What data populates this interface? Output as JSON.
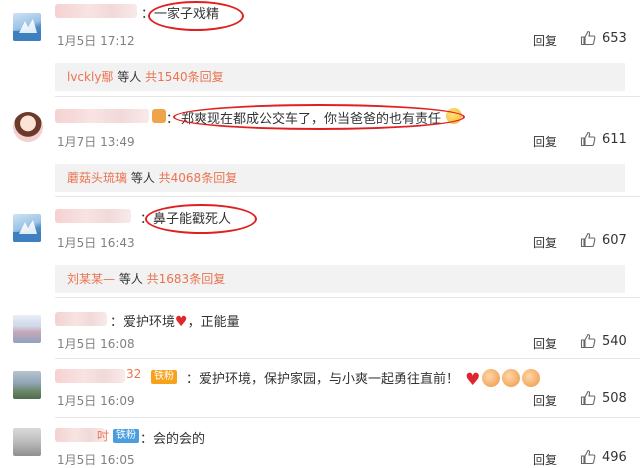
{
  "comments": [
    {
      "text": "：一家子戏精",
      "time": "1月5日 17:12",
      "reply": "回复",
      "likes": "653",
      "replies": {
        "users": "lvckly鄢",
        "mid": " 等人 ",
        "total": "共1540条回复"
      }
    },
    {
      "text_prefix": "：",
      "text": "郑爽现在都成公交车了，你当爸爸的也有责任",
      "time": "1月7日 13:49",
      "reply": "回复",
      "likes": "611",
      "replies": {
        "users": "蘑菇头琉璃",
        "mid": " 等人 ",
        "total": "共4068条回复"
      }
    },
    {
      "text": "：鼻子能戳死人",
      "time": "1月5日 16:43",
      "reply": "回复",
      "likes": "607",
      "replies": {
        "users": "刘某某—",
        "mid": " 等人 ",
        "total": "共1683条回复"
      }
    },
    {
      "text": "：爱护环境",
      "text_tail": "，正能量",
      "time": "1月5日 16:08",
      "reply": "回复",
      "likes": "540"
    },
    {
      "name_tail": "32",
      "badge": "铁粉",
      "text": "：爱护环境，保护家园，与小爽一起勇往直前！",
      "time": "1月5日 16:09",
      "reply": "回复",
      "likes": "508"
    },
    {
      "name_tail": "吋",
      "badge": "铁粉",
      "text": "：会的会的",
      "time": "1月5日 16:05",
      "reply": "回复",
      "likes": "496"
    }
  ],
  "icons": {
    "like": "thumbs-up-icon",
    "heart": "heart-emoji",
    "clap": "clap-emoji"
  },
  "colors": {
    "accent_link": "#eb7350",
    "annotation_red": "#e02020",
    "badge_orange": "#f7a21b",
    "badge_blue": "#4a9ee0"
  }
}
